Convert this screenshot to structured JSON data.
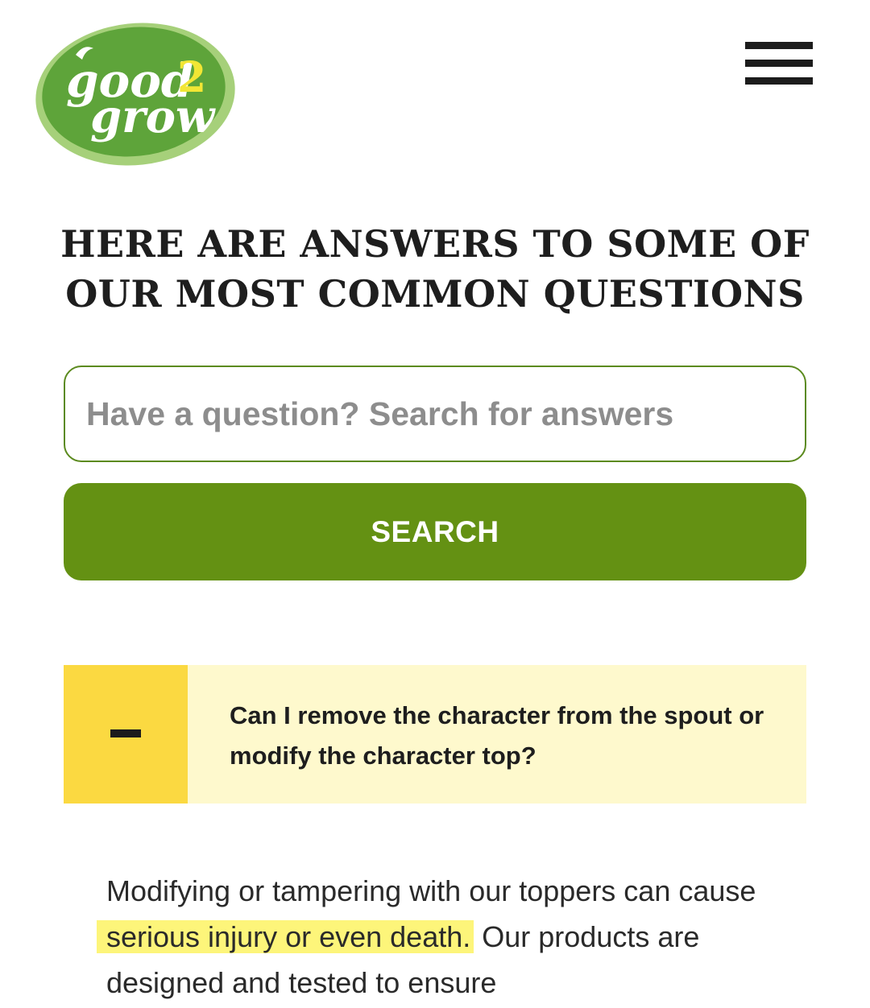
{
  "brand": {
    "logo_word_1": "good",
    "logo_number": "2",
    "logo_word_2": "grow",
    "colors": {
      "logo_green": "#5ea43a",
      "logo_light_green": "#9ccc63",
      "logo_yellow": "#f2e634",
      "accent_green": "#649113",
      "toggle_yellow": "#fbd941",
      "question_bg": "#fef9cd",
      "highlight": "#fdf57a"
    }
  },
  "header": {
    "menu_icon": "hamburger-menu-icon"
  },
  "main": {
    "title": "HERE ARE ANSWERS TO SOME OF OUR MOST COMMON QUESTIONS",
    "search": {
      "placeholder": "Have a question? Search for answers",
      "value": "",
      "button_label": "SEARCH"
    },
    "faq": {
      "toggle_icon": "minus-icon",
      "expanded": true,
      "question": "Can I remove the character from the spout or modify the character top?",
      "answer_before": "Modifying or tampering with our toppers can cause",
      "answer_highlight": "serious injury or even death.",
      "answer_after": "Our products are designed and tested to ensure"
    }
  }
}
